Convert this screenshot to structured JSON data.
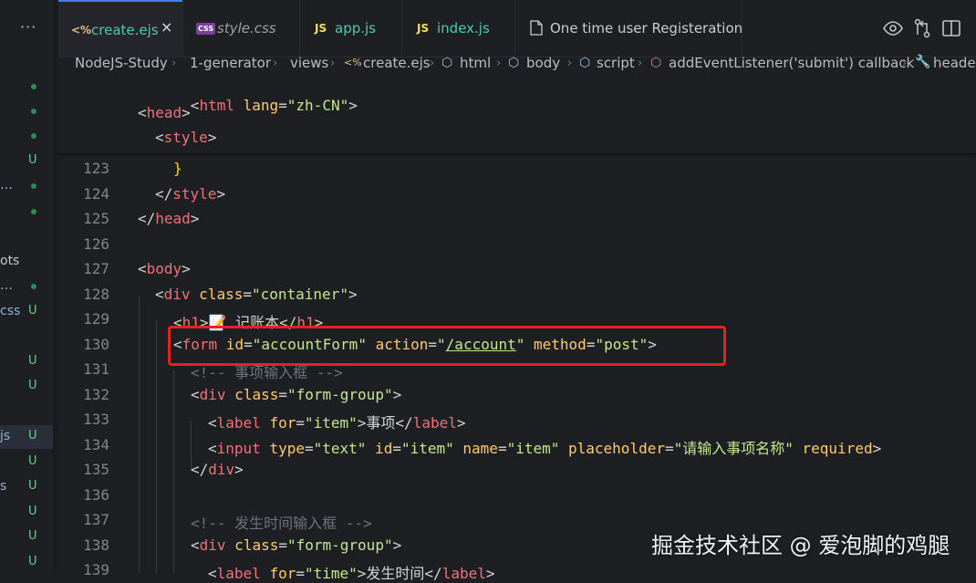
{
  "explorer": {
    "more_label": "···",
    "rows": [
      {
        "frag": "",
        "mark": "dot"
      },
      {
        "frag": "",
        "mark": "dot"
      },
      {
        "frag": "",
        "mark": "dot"
      },
      {
        "frag": "",
        "mark": "U"
      },
      {
        "frag": "…",
        "mark": "dot"
      },
      {
        "frag": "",
        "mark": "dot"
      },
      {
        "frag": "",
        "mark": ""
      },
      {
        "frag": "ots",
        "mark": ""
      },
      {
        "frag": "…",
        "mark": "dot"
      },
      {
        "frag": "css",
        "mark": "U"
      },
      {
        "frag": "",
        "mark": ""
      },
      {
        "frag": "",
        "mark": "U"
      },
      {
        "frag": "",
        "mark": "U"
      },
      {
        "frag": "",
        "mark": ""
      },
      {
        "frag": "js",
        "mark": "U"
      },
      {
        "frag": "",
        "mark": "U"
      },
      {
        "frag": "s",
        "mark": "U"
      },
      {
        "frag": "",
        "mark": "U"
      },
      {
        "frag": "",
        "mark": "U"
      },
      {
        "frag": "",
        "mark": "U"
      }
    ]
  },
  "tabs": [
    {
      "icon": "<%",
      "label": "create.ejs",
      "active": true,
      "icon_color": "#e2c08d"
    },
    {
      "icon": "CSS",
      "label": "style.css",
      "active": false,
      "icon_color": "#c586c0"
    },
    {
      "icon": "JS",
      "label": "app.js",
      "active": false,
      "icon_color": "#f1e05a"
    },
    {
      "icon": "JS",
      "label": "index.js",
      "active": false,
      "icon_color": "#f1e05a"
    },
    {
      "icon": "file",
      "label": "One time user Registeration",
      "active": false,
      "icon_color": "#cccccc"
    }
  ],
  "tab_close": "×",
  "breadcrumb": [
    "NodeJS-Study",
    "1-generator",
    "views",
    "create.ejs",
    "html",
    "body",
    "script",
    "addEventListener('submit') callback",
    "header"
  ],
  "sticky": [
    "<html lang=\"zh-CN\">",
    "<head>",
    "<style>"
  ],
  "lines": [
    {
      "n": "123"
    },
    {
      "n": "124"
    },
    {
      "n": "125"
    },
    {
      "n": "126"
    },
    {
      "n": "127"
    },
    {
      "n": "128"
    },
    {
      "n": "129"
    },
    {
      "n": "130"
    },
    {
      "n": "131"
    },
    {
      "n": "132"
    },
    {
      "n": "133"
    },
    {
      "n": "134"
    },
    {
      "n": "135"
    },
    {
      "n": "136"
    },
    {
      "n": "137"
    },
    {
      "n": "138"
    },
    {
      "n": "139"
    }
  ],
  "code": {
    "l123": "}",
    "l124a": "</",
    "l124b": "style",
    "l124c": ">",
    "l125a": "</",
    "l125b": "head",
    "l125c": ">",
    "l127a": "<",
    "l127b": "body",
    "l127c": ">",
    "l128a": "<",
    "l128b": "div",
    "l128c": " class",
    "l128d": "=",
    "l128e": "\"container\"",
    "l128f": ">",
    "l129a": "<",
    "l129b": "h1",
    "l129c": ">📝 记账本</",
    "l129d": "h1",
    "l129e": ">",
    "l130a": "<",
    "l130b": "form",
    "l130c": " id",
    "l130d": "=",
    "l130e": "\"accountForm\"",
    "l130f": " action",
    "l130g": "=",
    "l130h": "\"",
    "l130i": "/account",
    "l130j": "\"",
    "l130k": " method",
    "l130l": "=",
    "l130m": "\"post\"",
    "l130n": ">",
    "l131": "<!-- 事项输入框 -->",
    "l132a": "<",
    "l132b": "div",
    "l132c": " class",
    "l132d": "=",
    "l132e": "\"form-group\"",
    "l132f": ">",
    "l133a": "<",
    "l133b": "label",
    "l133c": " for",
    "l133d": "=",
    "l133e": "\"item\"",
    "l133f": ">事项</",
    "l133g": "label",
    "l133h": ">",
    "l134a": "<",
    "l134b": "input",
    "l134c": " type",
    "l134d": "=",
    "l134e": "\"text\"",
    "l134f": " id",
    "l134g": "=",
    "l134h": "\"item\"",
    "l134i": " name",
    "l134j": "=",
    "l134k": "\"item\"",
    "l134l": " placeholder",
    "l134m": "=",
    "l134n": "\"请输入事项名称\"",
    "l134o": " required",
    "l134p": ">",
    "l135a": "</",
    "l135b": "div",
    "l135c": ">",
    "l137": "<!-- 发生时间输入框 -->",
    "l138a": "<",
    "l138b": "div",
    "l138c": " class",
    "l138d": "=",
    "l138e": "\"form-group\"",
    "l138f": ">",
    "l139a": "<",
    "l139b": "label",
    "l139c": " for",
    "l139d": "=",
    "l139e": "\"time\"",
    "l139f": ">发生时间</",
    "l139g": "label",
    "l139h": ">"
  },
  "watermark": "掘金技术社区 @ 爱泡脚的鸡腿",
  "colors": {
    "highlight": "#e02424",
    "accent": "#3b82f6"
  }
}
